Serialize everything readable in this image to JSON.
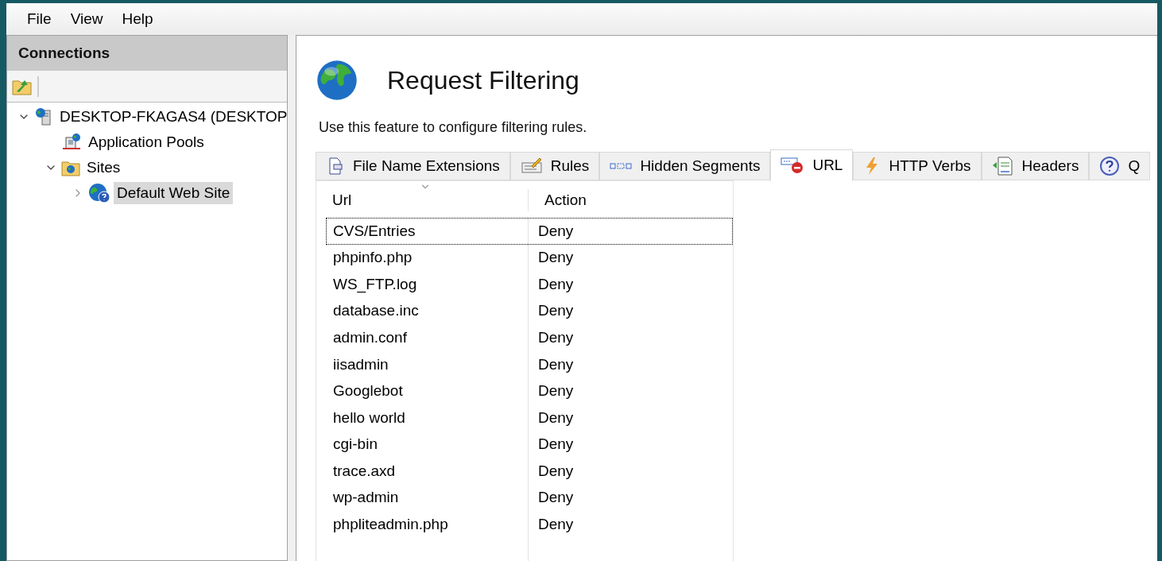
{
  "menu": [
    "File",
    "View",
    "Help"
  ],
  "connections": {
    "title": "Connections",
    "tree": [
      {
        "label": "DESKTOP-FKAGAS4 (DESKTOP",
        "kind": "server",
        "expanded": true,
        "selected": false,
        "children": [
          {
            "label": "Application Pools",
            "kind": "pools",
            "selected": false
          },
          {
            "label": "Sites",
            "kind": "folder",
            "expanded": true,
            "selected": false,
            "children": [
              {
                "label": "Default Web Site",
                "kind": "site",
                "expanded": false,
                "selected": true
              }
            ]
          }
        ]
      }
    ]
  },
  "feature": {
    "title": "Request Filtering",
    "description": "Use this feature to configure filtering rules."
  },
  "tabs": [
    {
      "label": "File Name Extensions",
      "kind": "file",
      "selected": false
    },
    {
      "label": "Rules",
      "kind": "rules",
      "selected": false
    },
    {
      "label": "Hidden Segments",
      "kind": "segments",
      "selected": false
    },
    {
      "label": "URL",
      "kind": "url",
      "selected": true
    },
    {
      "label": "HTTP Verbs",
      "kind": "verbs",
      "selected": false
    },
    {
      "label": "Headers",
      "kind": "headers",
      "selected": false
    },
    {
      "label": "Q",
      "kind": "help",
      "selected": false
    }
  ],
  "table": {
    "columns": [
      "Url",
      "Action"
    ],
    "rows": [
      {
        "url": "CVS/Entries",
        "action": "Deny",
        "selected": true
      },
      {
        "url": "phpinfo.php",
        "action": "Deny",
        "selected": false
      },
      {
        "url": "WS_FTP.log",
        "action": "Deny",
        "selected": false
      },
      {
        "url": "database.inc",
        "action": "Deny",
        "selected": false
      },
      {
        "url": "admin.conf",
        "action": "Deny",
        "selected": false
      },
      {
        "url": "iisadmin",
        "action": "Deny",
        "selected": false
      },
      {
        "url": "Googlebot",
        "action": "Deny",
        "selected": false
      },
      {
        "url": "hello world",
        "action": "Deny",
        "selected": false
      },
      {
        "url": "cgi-bin",
        "action": "Deny",
        "selected": false
      },
      {
        "url": "trace.axd",
        "action": "Deny",
        "selected": false
      },
      {
        "url": "wp-admin",
        "action": "Deny",
        "selected": false
      },
      {
        "url": "phpliteadmin.php",
        "action": "Deny",
        "selected": false
      }
    ]
  }
}
